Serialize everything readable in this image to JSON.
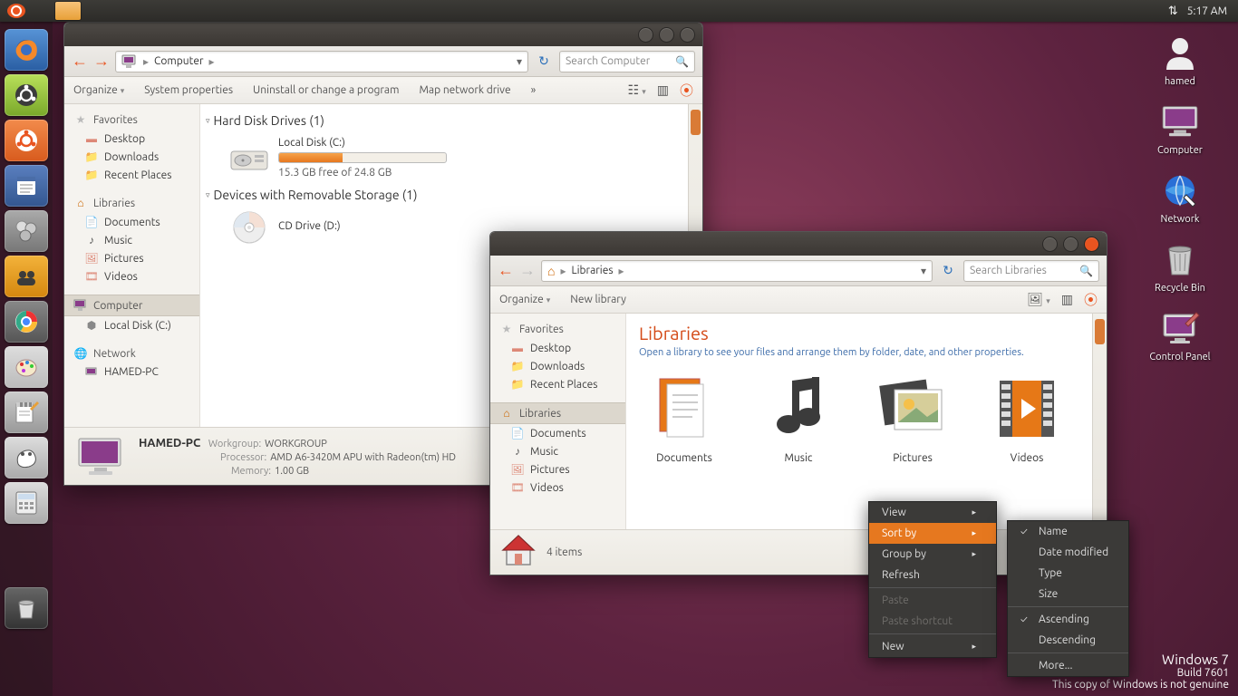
{
  "panel": {
    "time": "5:17 AM"
  },
  "desktop_icons": [
    "hamed",
    "Computer",
    "Network",
    "Recycle Bin",
    "Control Panel"
  ],
  "win1": {
    "crumb": "Computer",
    "search_placeholder": "Search Computer",
    "toolbar": {
      "organize": "Organize",
      "sysprops": "System properties",
      "uninstall": "Uninstall or change a program",
      "mapnet": "Map network drive"
    },
    "sidebar": {
      "favorites": "Favorites",
      "fav_items": [
        "Desktop",
        "Downloads",
        "Recent Places"
      ],
      "libraries": "Libraries",
      "lib_items": [
        "Documents",
        "Music",
        "Pictures",
        "Videos"
      ],
      "computer": "Computer",
      "comp_items": [
        "Local Disk (C:)"
      ],
      "network": "Network",
      "net_items": [
        "HAMED-PC"
      ]
    },
    "section_hdd": "Hard Disk Drives (1)",
    "drive": {
      "name": "Local Disk (C:)",
      "sub": "15.3 GB free of 24.8 GB",
      "fill_pct": 38
    },
    "section_removable": "Devices with Removable Storage (1)",
    "cd": "CD Drive (D:)",
    "status": {
      "name": "HAMED-PC",
      "workgroup_label": "Workgroup:",
      "workgroup": "WORKGROUP",
      "processor_label": "Processor:",
      "processor": "AMD A6-3420M APU with Radeon(tm) HD",
      "memory_label": "Memory:",
      "memory": "1.00 GB"
    }
  },
  "win2": {
    "crumb": "Libraries",
    "search_placeholder": "Search Libraries",
    "toolbar": {
      "organize": "Organize",
      "newlib": "New library"
    },
    "sidebar": {
      "favorites": "Favorites",
      "fav_items": [
        "Desktop",
        "Downloads",
        "Recent Places"
      ],
      "libraries": "Libraries",
      "lib_items": [
        "Documents",
        "Music",
        "Pictures",
        "Videos"
      ]
    },
    "title": "Libraries",
    "subtitle": "Open a library to see your files and arrange them by folder, date, and other properties.",
    "items": [
      "Documents",
      "Music",
      "Pictures",
      "Videos"
    ],
    "status": "4 items"
  },
  "context_menu": {
    "items": [
      {
        "label": "View",
        "arrow": true
      },
      {
        "label": "Sort by",
        "arrow": true,
        "hl": true
      },
      {
        "label": "Group by",
        "arrow": true
      },
      {
        "label": "Refresh"
      }
    ],
    "sep1": true,
    "items2": [
      {
        "label": "Paste",
        "dis": true
      },
      {
        "label": "Paste shortcut",
        "dis": true
      }
    ],
    "sep2": true,
    "items3": [
      {
        "label": "New",
        "arrow": true
      }
    ],
    "sub": [
      {
        "label": "Name",
        "chk": true
      },
      {
        "label": "Date modified"
      },
      {
        "label": "Type"
      },
      {
        "label": "Size"
      }
    ],
    "sub2": [
      {
        "label": "Ascending",
        "chk": true
      },
      {
        "label": "Descending"
      }
    ],
    "sub3": [
      {
        "label": "More..."
      }
    ]
  },
  "watermark": {
    "line1": "Windows 7",
    "line2": "Build 7601",
    "line3": "This copy of Windows is not genuine"
  }
}
